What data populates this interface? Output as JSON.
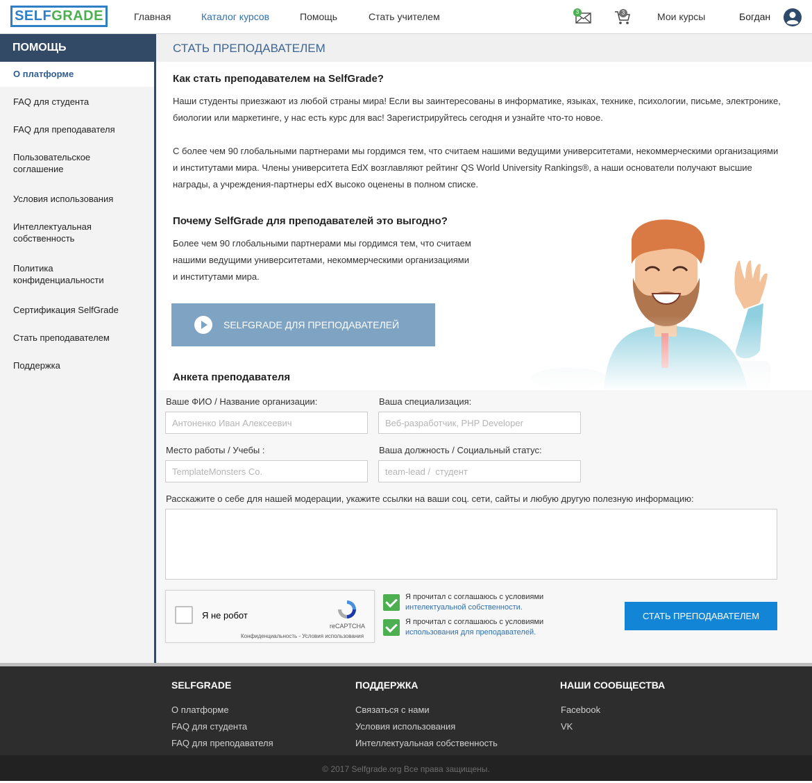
{
  "brand": {
    "logo_part1": "SELF",
    "logo_part2": "GRADE"
  },
  "nav": {
    "home": "Главная",
    "catalog": "Каталог курсов",
    "help": "Помощь",
    "become_teacher": "Стать учителем",
    "messages_count": "3",
    "cart_count": "3",
    "my_courses": "Мои курсы",
    "user_name": "Богдан"
  },
  "sidebar": {
    "title": "Помощь",
    "items": [
      {
        "label": "О платформе"
      },
      {
        "label": "FAQ для студента"
      },
      {
        "label": "FAQ для преподавателя"
      },
      {
        "label": "Пользовательское соглашение"
      },
      {
        "label": "Условия использования"
      },
      {
        "label": "Интеллектуальная собственность"
      },
      {
        "label": "Политика конфиденциальности"
      },
      {
        "label": "Сертификация SelfGrade"
      },
      {
        "label": "Стать преподавателем"
      },
      {
        "label": "Поддержка"
      }
    ]
  },
  "main": {
    "page_title": "Стать преподавателем",
    "section1_title": "Как стать преподавателем на SelfGrade?",
    "section1_p1": "Наши студенты приезжают из любой страны мира! Если вы заинтересованы в информатике, языках, технике, психологии, письме, электронике, биологии или маркетинге, у нас есть курс для вас! Зарегистрируйтесь сегодня и узнайте что-то новое.",
    "section1_p2": "С более чем 90 глобальными партнерами мы гордимся тем, что считаем нашими ведущими университетами, некоммерческими организациями и институтами мира. Члены университета EdX возглавляют рейтинг QS World University Rankings®, а наши основатели получают высшие награды, а учреждения-партнеры edX высоко оценены в полном списке.",
    "section2_title": "Почему SelfGrade для преподавателей это выгодно?",
    "section2_p": "Более чем 90 глобальными партнерами мы гордимся тем, что считаем нашими ведущими университетами, некоммерческими организациями и институтами мира.",
    "video_button": "SelfGrade для преподавателей",
    "form_title": "Анкета преподавателя"
  },
  "form": {
    "name_label": "Ваше ФИО / Название организации:",
    "name_placeholder": "Антоненко Иван Алексеевич",
    "spec_label": "Ваша специализация:",
    "spec_placeholder": "Веб-разработчик, PHP Developer",
    "work_label": "Место работы / Учебы :",
    "work_placeholder": "TemplateMonsters Co.",
    "position_label": "Ваша должность / Социальный статус:",
    "position_placeholder": "team-lead /  студент",
    "about_label": "Расскажите о себе для нашей модерации, укажите ссылки на ваши соц. сети, сайты и любую другую полезную информацию:",
    "captcha_label": "Я не робот",
    "captcha_brand": "reCAPTCHA",
    "captcha_links": "Конфиденциальность - Условия использования",
    "agree1_text": "Я прочитал с соглашаюсь с условиями",
    "agree1_link": "интелектуальной собственности.",
    "agree2_text": "Я прочитал с соглашаюсь с условиями",
    "agree2_link": "использования для преподавателей.",
    "submit": "Стать преподавателем"
  },
  "footer": {
    "col1_title": "SelfGrade",
    "col1_links": [
      "О платформе",
      "FAQ для студента",
      "FAQ для преподавателя"
    ],
    "col2_title": "Поддержка",
    "col2_links": [
      "Связаться с нами",
      "Условия использования",
      "Интеллектуальная собственность"
    ],
    "col3_title": "Наши сообщества",
    "col3_links": [
      "Facebook",
      "VK"
    ],
    "copyright": "© 2017 Selfgrade.org Все права защищены."
  },
  "colors": {
    "primary": "#1385d7",
    "sidebar_dark": "#324a66",
    "check_green": "#4caf50",
    "video_button": "#7fa3c2"
  }
}
